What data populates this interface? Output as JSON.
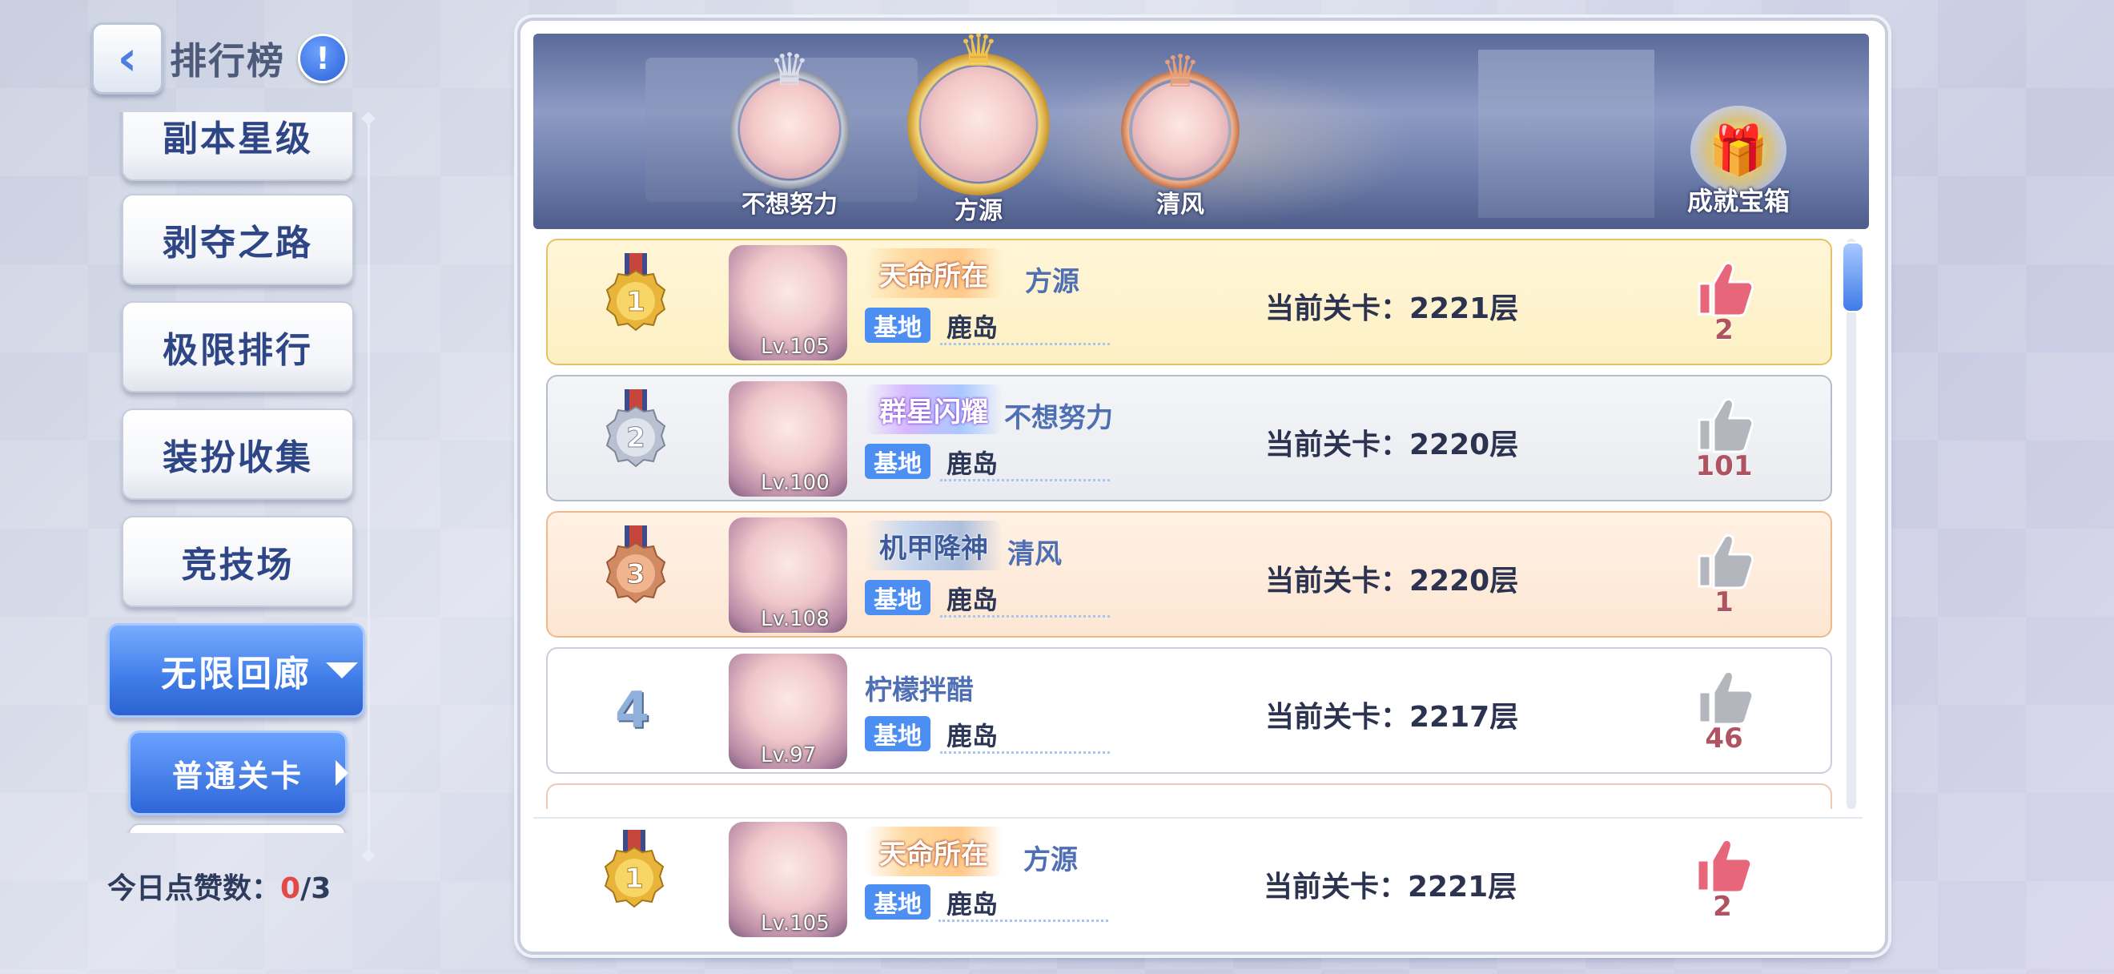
{
  "header": {
    "title": "排行榜",
    "back_icon": "chevron-left-icon",
    "info_label": "!"
  },
  "sidebar": {
    "items": [
      {
        "label": "副本星级"
      },
      {
        "label": "剥夺之路"
      },
      {
        "label": "极限排行"
      },
      {
        "label": "装扮收集"
      },
      {
        "label": "竞技场"
      },
      {
        "label": "无限回廊",
        "active": true
      },
      {
        "label": "普通关卡",
        "sub": true
      }
    ]
  },
  "likes_today": {
    "label": "今日点赞数：",
    "used": "0",
    "total": "/3"
  },
  "podium": {
    "first": {
      "name": "方源"
    },
    "second": {
      "name": "不想努力"
    },
    "third": {
      "name": "清风"
    },
    "chest_label": "成就宝箱"
  },
  "rows": [
    {
      "rank": "1",
      "title": "天命所在",
      "name": "方源",
      "level": "Lv.105",
      "base_tag": "基地",
      "base": "鹿岛",
      "stage": "当前关卡：2221层",
      "likes": "2",
      "liked": true
    },
    {
      "rank": "2",
      "title": "群星闪耀",
      "name": "不想努力",
      "level": "Lv.100",
      "base_tag": "基地",
      "base": "鹿岛",
      "stage": "当前关卡：2220层",
      "likes": "101",
      "liked": false
    },
    {
      "rank": "3",
      "title": "机甲降神",
      "name": "清风",
      "level": "Lv.108",
      "base_tag": "基地",
      "base": "鹿岛",
      "stage": "当前关卡：2220层",
      "likes": "1",
      "liked": false
    },
    {
      "rank": "4",
      "title": "",
      "name": "柠檬拌醋",
      "level": "Lv.97",
      "base_tag": "基地",
      "base": "鹿岛",
      "stage": "当前关卡：2217层",
      "likes": "46",
      "liked": false
    }
  ],
  "my_row": {
    "rank": "1",
    "title": "天命所在",
    "name": "方源",
    "level": "Lv.105",
    "base_tag": "基地",
    "base": "鹿岛",
    "stage": "当前关卡：2221层",
    "likes": "2",
    "liked": true
  },
  "colors": {
    "accent_blue": "#3f7ce8",
    "gold": "#e6c266",
    "silver": "#b5bccb",
    "bronze": "#f0b989",
    "like_pink": "#e8667a"
  }
}
